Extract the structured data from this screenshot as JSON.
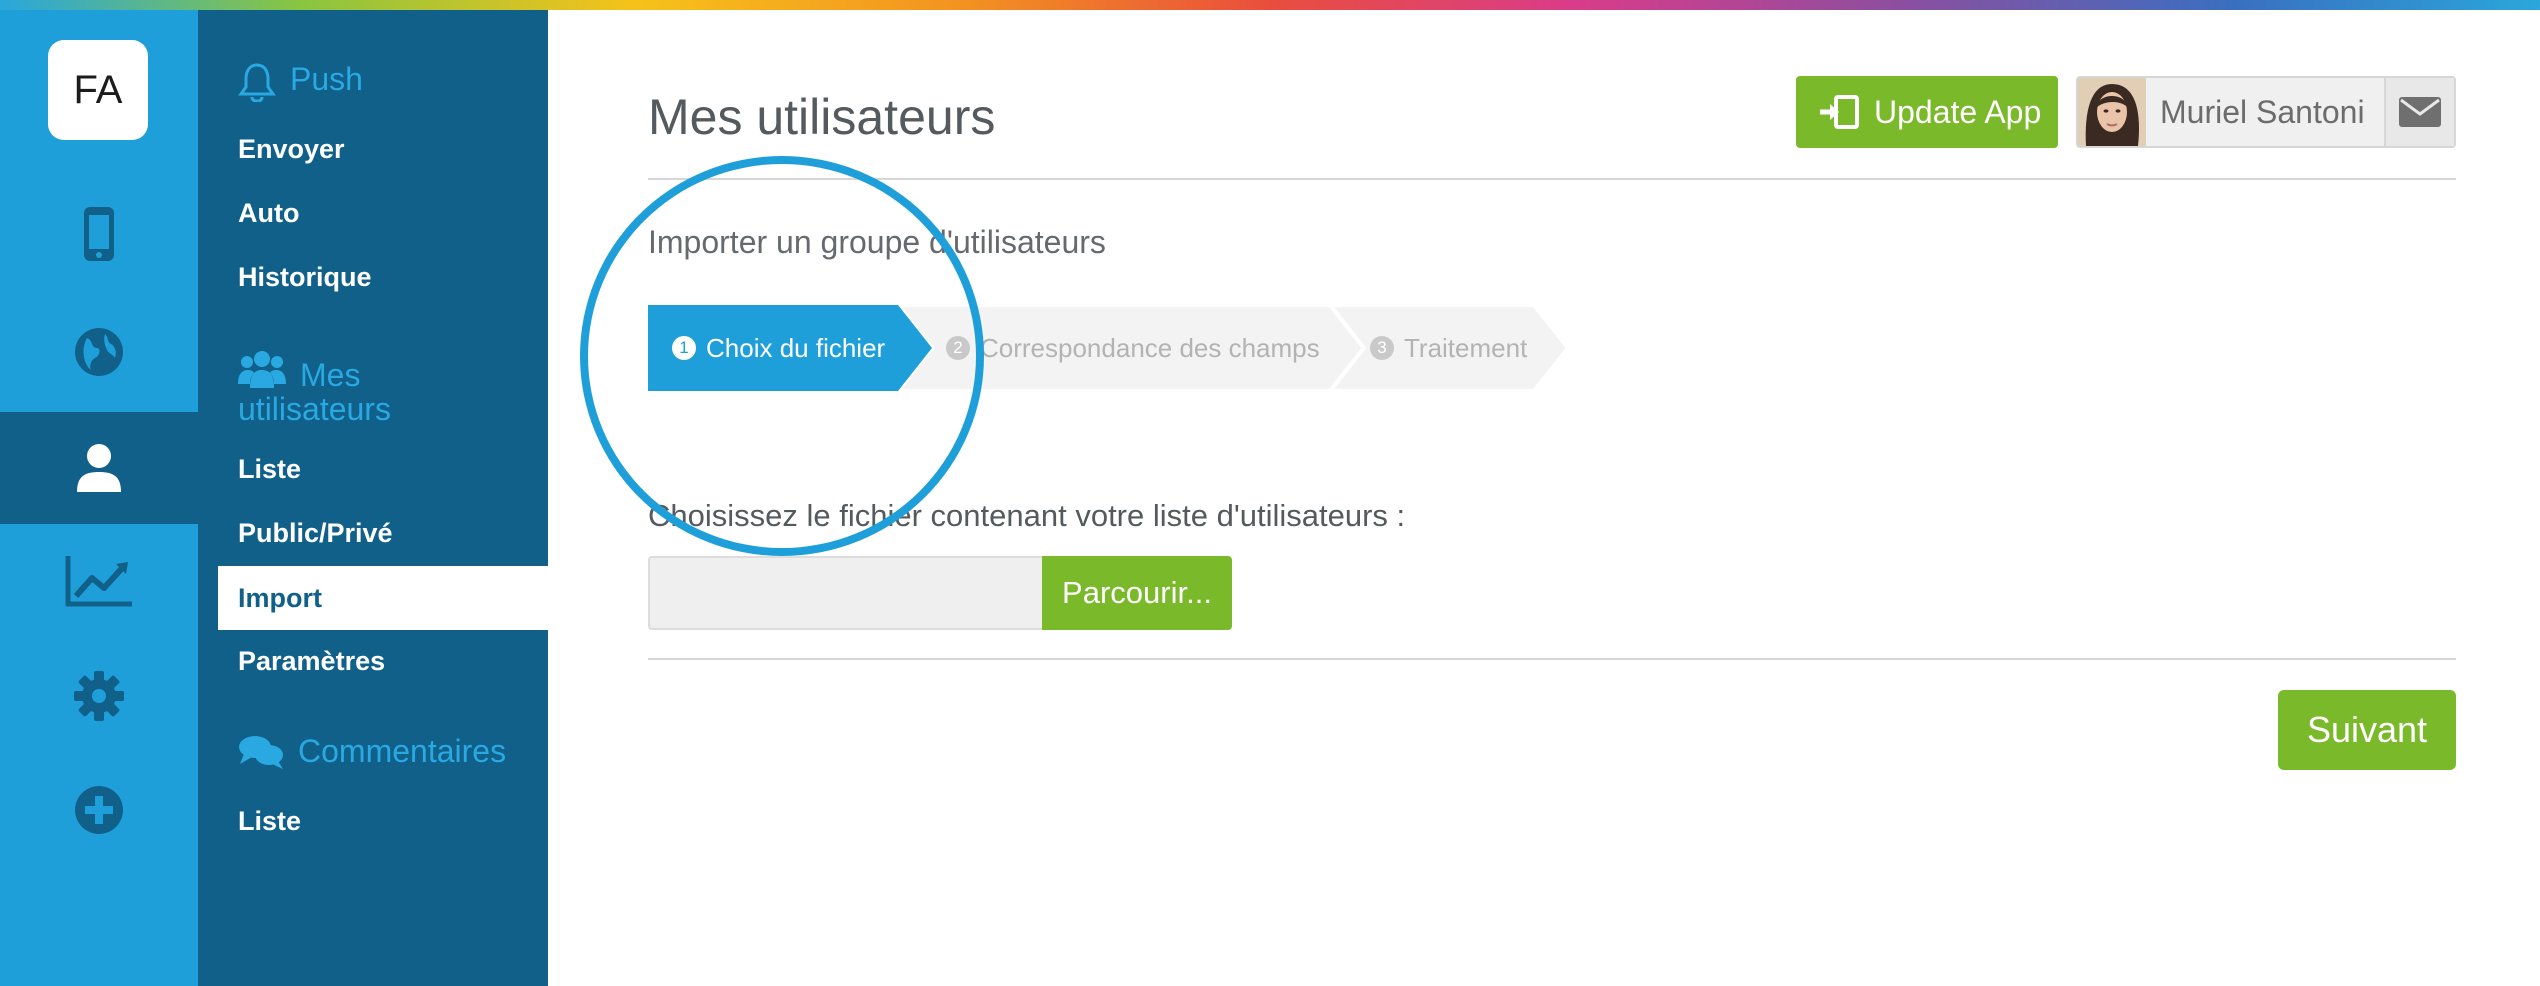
{
  "logo": {
    "text": "FA"
  },
  "rail": {
    "items": [
      {
        "name": "mobile",
        "icon": "mobile-phone-icon"
      },
      {
        "name": "globe",
        "icon": "globe-icon"
      },
      {
        "name": "users",
        "icon": "user-icon",
        "active": true
      },
      {
        "name": "stats",
        "icon": "line-chart-icon"
      },
      {
        "name": "settings",
        "icon": "gear-icon"
      },
      {
        "name": "add",
        "icon": "plus-circle-icon"
      }
    ],
    "active_color": "#10608a"
  },
  "subnav": {
    "push": {
      "title": "Push",
      "icon": "bell-icon",
      "links": [
        "Envoyer",
        "Auto",
        "Historique"
      ]
    },
    "users": {
      "title_line1": "Mes",
      "title_line2": "utilisateurs",
      "icon": "users-icon",
      "links": [
        "Liste",
        "Public/Privé",
        "Import",
        "Paramètres"
      ],
      "active_link": "Import"
    },
    "comments": {
      "title": "Commentaires",
      "icon": "comments-icon",
      "links": [
        "Liste"
      ]
    }
  },
  "header": {
    "title": "Mes utilisateurs",
    "update_button": "Update App",
    "user_name": "Muriel Santoni",
    "mail_icon": "envelope-icon"
  },
  "import": {
    "heading": "Importer un groupe d'utilisateurs",
    "steps": [
      {
        "num": "1",
        "label": "Choix du fichier",
        "active": true
      },
      {
        "num": "2",
        "label": "Correspondance des champs",
        "active": false
      },
      {
        "num": "3",
        "label": "Traitement",
        "active": false
      }
    ],
    "file_label": "Choisissez le fichier contenant votre liste d'utilisateurs :",
    "file_value": "",
    "browse_button": "Parcourir...",
    "next_button": "Suivant"
  },
  "colors": {
    "rail": "#1f9fda",
    "subnav": "#10608a",
    "accent_green": "#7ab929",
    "section_title": "#29a8e2"
  }
}
